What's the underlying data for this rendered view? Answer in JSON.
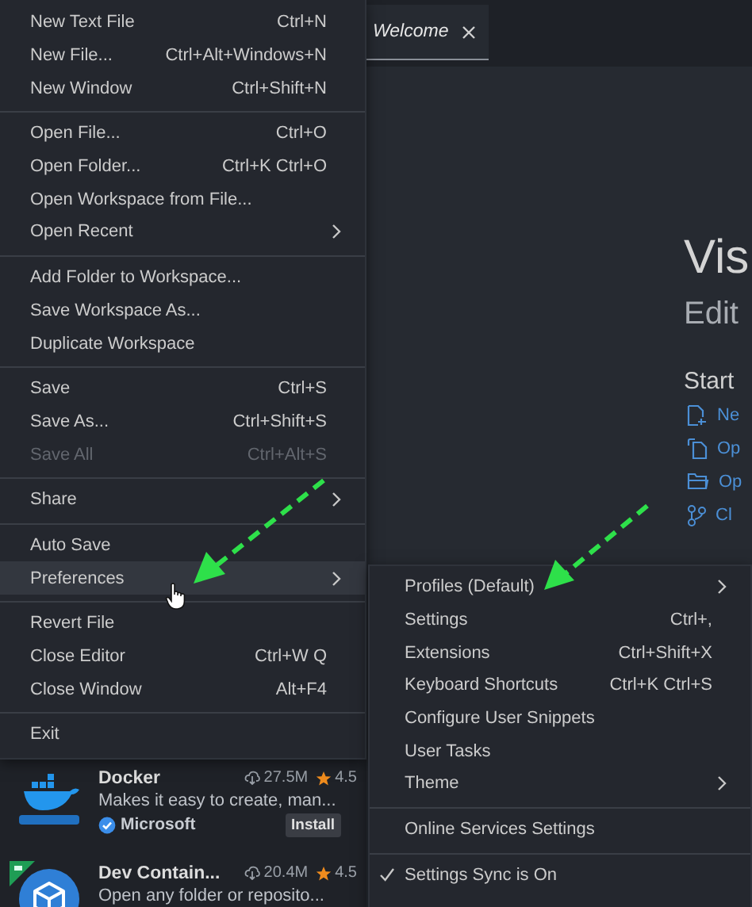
{
  "file_menu": {
    "groups": [
      [
        {
          "label": "New Text File",
          "shortcut": "Ctrl+N",
          "submenu": false,
          "disabled": false,
          "highlighted": false
        },
        {
          "label": "New File...",
          "shortcut": "Ctrl+Alt+Windows+N",
          "submenu": false,
          "disabled": false,
          "highlighted": false
        },
        {
          "label": "New Window",
          "shortcut": "Ctrl+Shift+N",
          "submenu": false,
          "disabled": false,
          "highlighted": false
        }
      ],
      [
        {
          "label": "Open File...",
          "shortcut": "Ctrl+O",
          "submenu": false,
          "disabled": false,
          "highlighted": false
        },
        {
          "label": "Open Folder...",
          "shortcut": "Ctrl+K Ctrl+O",
          "submenu": false,
          "disabled": false,
          "highlighted": false
        },
        {
          "label": "Open Workspace from File...",
          "submenu": false,
          "disabled": false,
          "highlighted": false
        },
        {
          "label": "Open Recent",
          "submenu": true,
          "disabled": false,
          "highlighted": false
        }
      ],
      [
        {
          "label": "Add Folder to Workspace...",
          "submenu": false,
          "disabled": false,
          "highlighted": false
        },
        {
          "label": "Save Workspace As...",
          "submenu": false,
          "disabled": false,
          "highlighted": false
        },
        {
          "label": "Duplicate Workspace",
          "submenu": false,
          "disabled": false,
          "highlighted": false
        }
      ],
      [
        {
          "label": "Save",
          "shortcut": "Ctrl+S",
          "submenu": false,
          "disabled": false,
          "highlighted": false
        },
        {
          "label": "Save As...",
          "shortcut": "Ctrl+Shift+S",
          "submenu": false,
          "disabled": false,
          "highlighted": false
        },
        {
          "label": "Save All",
          "shortcut": "Ctrl+Alt+S",
          "submenu": false,
          "disabled": true,
          "highlighted": false
        }
      ],
      [
        {
          "label": "Share",
          "submenu": true,
          "disabled": false,
          "highlighted": false
        }
      ],
      [
        {
          "label": "Auto Save",
          "submenu": false,
          "disabled": false,
          "highlighted": false
        },
        {
          "label": "Preferences",
          "submenu": true,
          "disabled": false,
          "highlighted": true
        }
      ],
      [
        {
          "label": "Revert File",
          "submenu": false,
          "disabled": false,
          "highlighted": false
        },
        {
          "label": "Close Editor",
          "shortcut": "Ctrl+W Q",
          "submenu": false,
          "disabled": false,
          "highlighted": false
        },
        {
          "label": "Close Window",
          "shortcut": "Alt+F4",
          "submenu": false,
          "disabled": false,
          "highlighted": false
        }
      ],
      [
        {
          "label": "Exit",
          "submenu": false,
          "disabled": false,
          "highlighted": false
        }
      ]
    ]
  },
  "preferences_submenu": {
    "groups": [
      [
        {
          "label": "Profiles (Default)",
          "submenu": true,
          "checked": false
        },
        {
          "label": "Settings",
          "shortcut": "Ctrl+,",
          "submenu": false,
          "checked": false
        },
        {
          "label": "Extensions",
          "shortcut": "Ctrl+Shift+X",
          "submenu": false,
          "checked": false
        },
        {
          "label": "Keyboard Shortcuts",
          "shortcut": "Ctrl+K Ctrl+S",
          "submenu": false,
          "checked": false
        },
        {
          "label": "Configure User Snippets",
          "submenu": false,
          "checked": false
        },
        {
          "label": "User Tasks",
          "submenu": false,
          "checked": false
        },
        {
          "label": "Theme",
          "submenu": true,
          "checked": false
        }
      ],
      [
        {
          "label": "Online Services Settings",
          "submenu": false,
          "checked": false
        }
      ],
      [
        {
          "label": "Settings Sync is On",
          "submenu": false,
          "checked": true
        }
      ]
    ]
  },
  "extensions": [
    {
      "name": "Docker",
      "downloads": "27.5M",
      "rating": "4.5",
      "description": "Makes it easy to create, man...",
      "publisher": "Microsoft",
      "action": "Install",
      "remote_badge": false
    },
    {
      "name": "Dev Contain...",
      "downloads": "20.4M",
      "rating": "4.5",
      "description": "Open any folder or reposito...",
      "remote_badge": true
    }
  ],
  "editor": {
    "tabs": [
      {
        "label": "Welcome",
        "selected": true
      }
    ],
    "welcome": {
      "title": "Vis",
      "subtitle": "Edit",
      "start_heading": "Start",
      "start_links": [
        "Ne",
        "Op",
        "Op",
        "Cl"
      ]
    }
  }
}
